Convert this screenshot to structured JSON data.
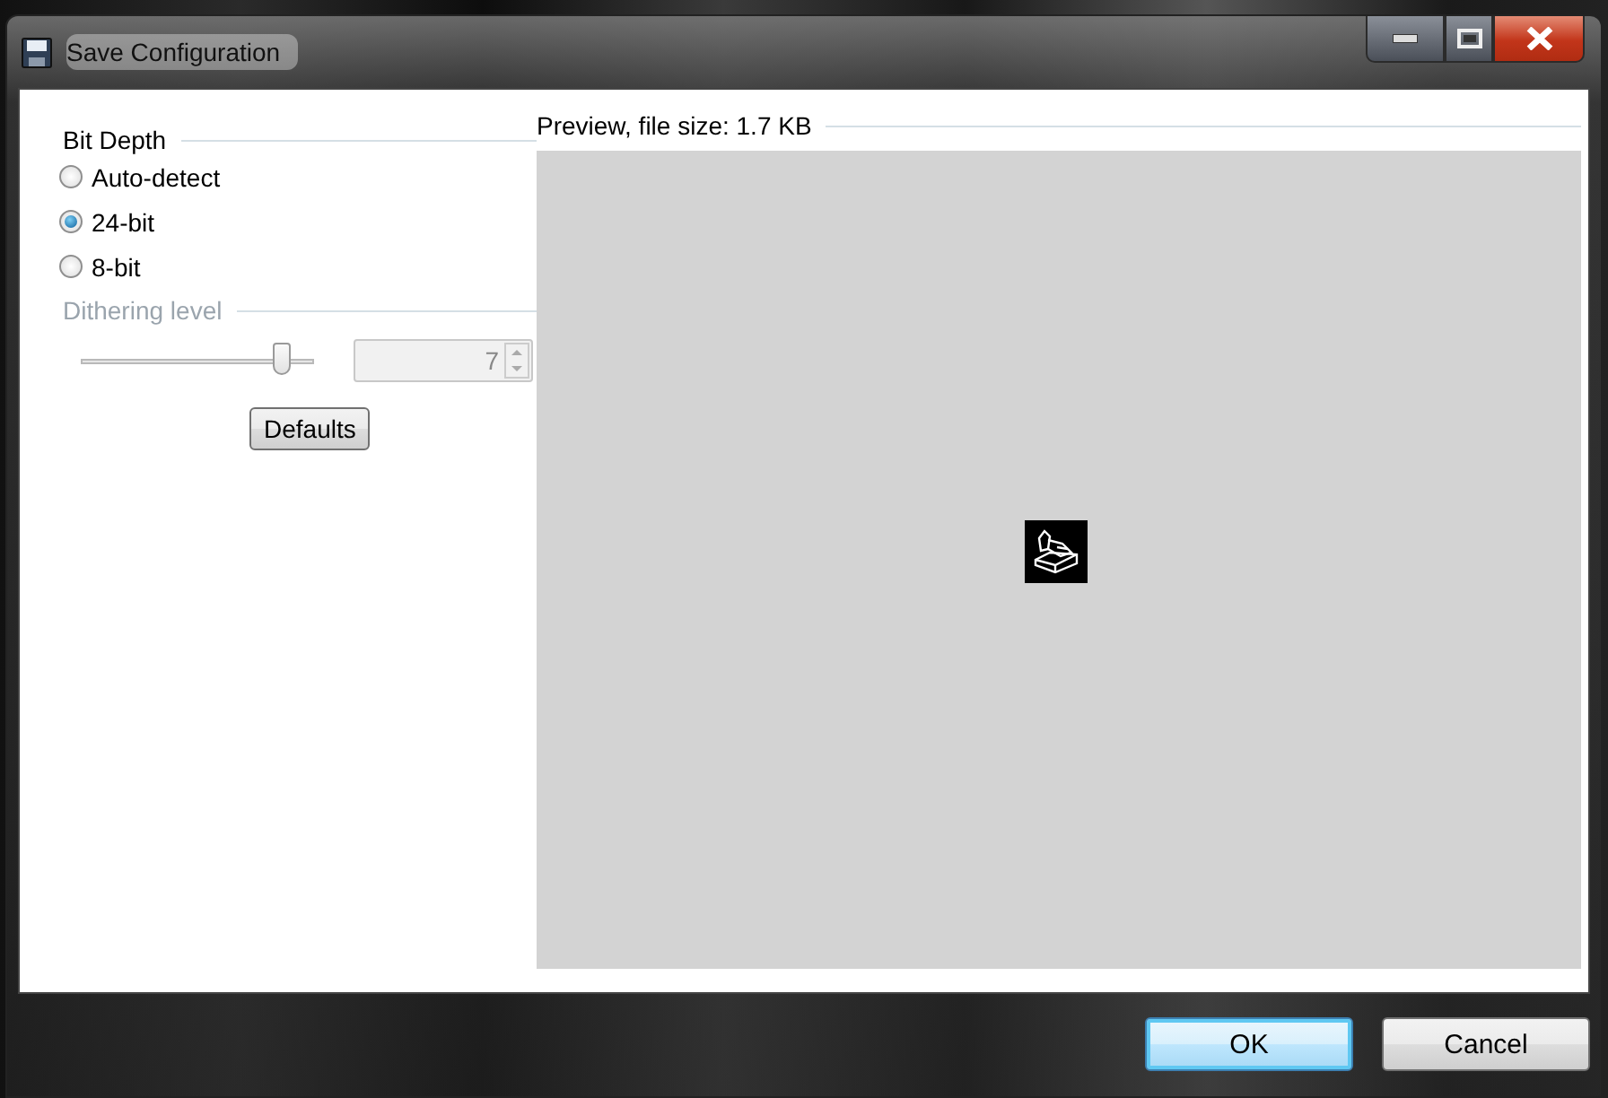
{
  "window": {
    "title": "Save Configuration"
  },
  "bit_depth": {
    "title": "Bit Depth",
    "options": [
      {
        "label": "Auto-detect",
        "selected": false
      },
      {
        "label": "24-bit",
        "selected": true
      },
      {
        "label": "8-bit",
        "selected": false
      }
    ]
  },
  "dithering": {
    "title": "Dithering level",
    "disabled": true,
    "level": 0.86,
    "value": "7"
  },
  "defaults_button": "Defaults",
  "preview": {
    "title": "Preview, file size: 1.7 KB"
  },
  "buttons": [
    {
      "label": "OK",
      "default": true
    },
    {
      "label": "Cancel",
      "default": false
    }
  ]
}
